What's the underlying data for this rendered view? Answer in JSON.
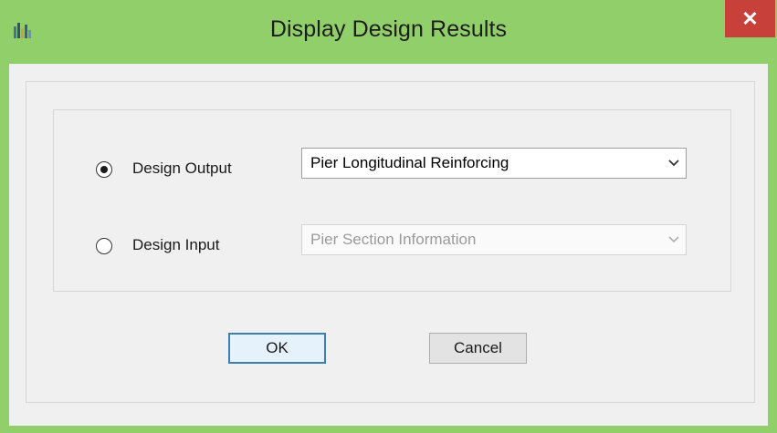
{
  "window": {
    "title": "Display Design Results",
    "icon": "etabs-app-icon",
    "close_label": "✕",
    "accent": "#91cf6b",
    "close_color": "#c7403a"
  },
  "options": {
    "output": {
      "label": "Design Output",
      "selected": true,
      "dropdown_value": "Pier Longitudinal Reinforcing",
      "enabled": true
    },
    "input": {
      "label": "Design Input",
      "selected": false,
      "dropdown_value": "Pier Section Information",
      "enabled": false
    }
  },
  "buttons": {
    "ok": "OK",
    "cancel": "Cancel"
  }
}
